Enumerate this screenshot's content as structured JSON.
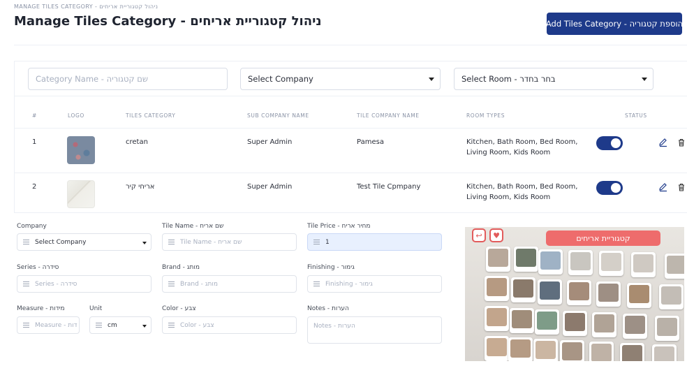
{
  "breadcrumb": "MANAGE TILES CATEGORY - ניהול קטגוריית אריחים",
  "page_title": "Manage Tiles Category - ניהול קטגוריית אריחים",
  "add_button": "Add Tiles Category - הוספת קטגוריה",
  "filters": {
    "category_name_placeholder": "Category Name - שם קטגוריה",
    "company_select": "Select Company",
    "room_select": "Select Room - בחר בחדר"
  },
  "table": {
    "headers": [
      "#",
      "LOGO",
      "TILES CATEGORY",
      "SUB COMPANY NAME",
      "TILE COMPANY NAME",
      "ROOM TYPES",
      "STATUS"
    ],
    "rows": [
      {
        "num": "1",
        "category": "cretan",
        "sub_company": "Super Admin",
        "tile_company": "Pamesa",
        "rooms_line1": "Kitchen, Bath Room, Bed Room,",
        "rooms_line2": "Living Room, Kids Room",
        "status": true
      },
      {
        "num": "2",
        "category": "אריחי קיר",
        "sub_company": "Super Admin",
        "tile_company": "Test Tile Cpmpany",
        "rooms_line1": "Kitchen, Bath Room, Bed Room,",
        "rooms_line2": "Living Room, Kids Room",
        "status": true
      }
    ]
  },
  "form": {
    "company_label": "Company",
    "company_value": "Select Company",
    "tile_name_label": "Tile Name - שם אריח",
    "tile_name_placeholder": "Tile Name - שם אריח",
    "tile_price_label": "Tile Price - מחיר אריח",
    "tile_price_value": "1",
    "series_label": "Series - סידרה",
    "series_placeholder": "Series - סידרה",
    "brand_label": "Brand - מותג",
    "brand_placeholder": "Brand - מותג",
    "finishing_label": "Finishing - גימור",
    "finishing_placeholder": "Finishing - גימור",
    "measure_label": "Measure - מידות",
    "measure_placeholder": "Measure - דות",
    "unit_label": "Unit",
    "unit_value": "cm",
    "color_label": "Color - צבע",
    "color_placeholder": "Color - צבע",
    "notes_label": "Notes - הערות",
    "notes_placeholder": "Notes - הערות"
  },
  "app_preview": {
    "title": "קטגוריית אריחים",
    "back_icon": "back-arrow-icon",
    "favorite_icon": "heart-icon"
  },
  "colors": {
    "primary": "#1e3a8a",
    "accent_red": "#ee6c6c"
  }
}
